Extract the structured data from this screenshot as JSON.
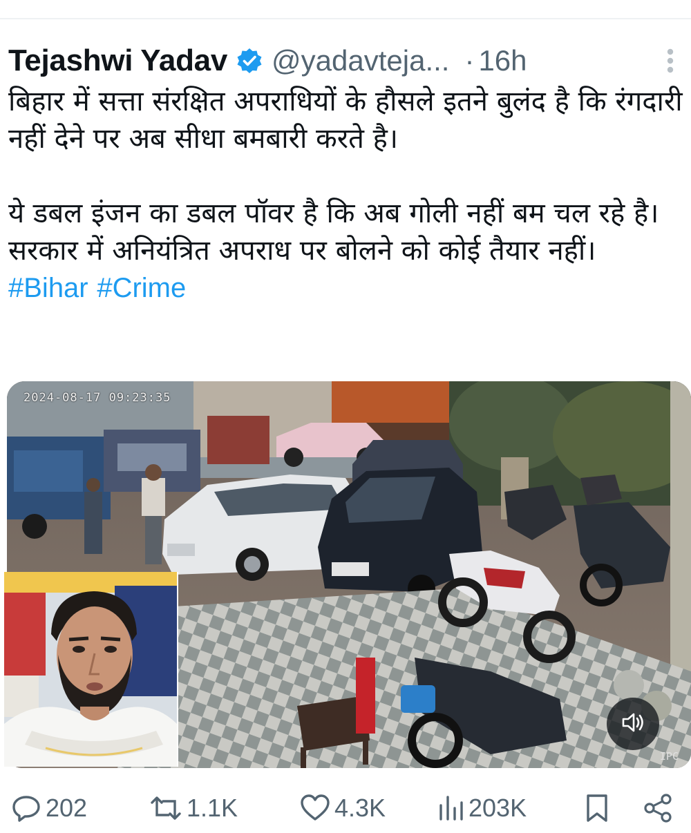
{
  "tweet": {
    "author": {
      "display_name": "Tejashwi Yadav",
      "handle": "@yadavteja...",
      "verified_icon": "verified-badge-icon",
      "verified_color": "#1d9bf0"
    },
    "separator": "·",
    "timestamp": "16h",
    "text": {
      "paragraph_1": "बिहार में सत्ता संरक्षित अपराधियों के हौसले इतने बुलंद है कि रंगदारी नहीं देने पर अब सीधा बमबारी करते है।",
      "paragraph_2": "ये डबल इंजन का डबल पॉवर है कि अब गोली नहीं बम चल रहे है। सरकार में अनियंत्रित अपराध पर बोलने को कोई तैयार नहीं।",
      "hashtags": [
        "#Bihar",
        "#Crime"
      ]
    },
    "media": {
      "cctv_overlay_timestamp": "2024-08-17 09:23:35",
      "cctv_channel_label": "IPC",
      "sound_icon": "speaker-icon"
    },
    "actions": {
      "replies": "202",
      "reposts": "1.1K",
      "likes": "4.3K",
      "views": "203K"
    },
    "colors": {
      "text": "#0f1419",
      "secondary": "#536471",
      "link": "#1d9bf0"
    }
  }
}
